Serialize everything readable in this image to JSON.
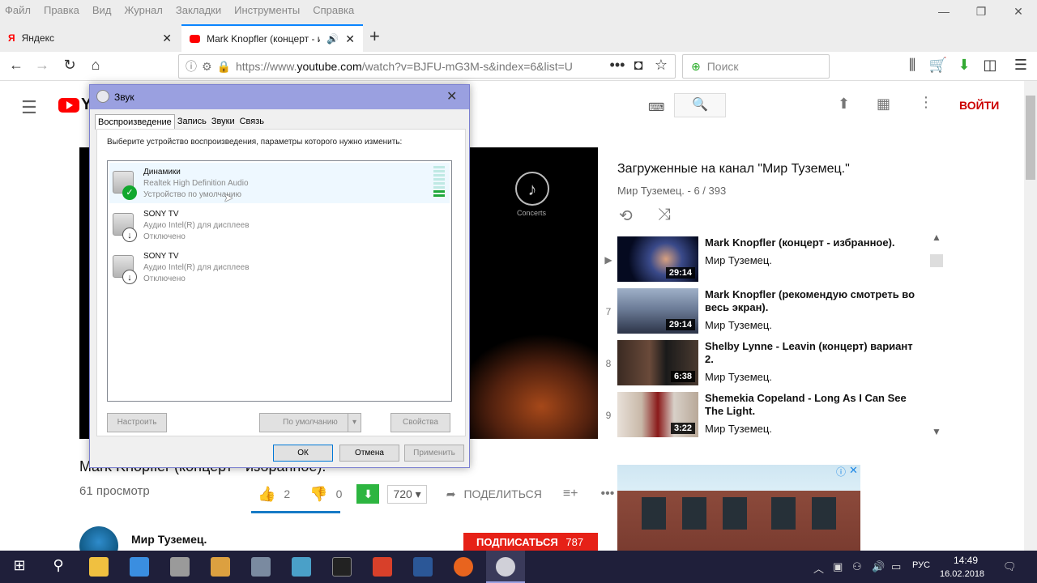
{
  "browser": {
    "menu": [
      "Файл",
      "Правка",
      "Вид",
      "Журнал",
      "Закладки",
      "Инструменты",
      "Справка"
    ],
    "tabs": [
      {
        "title": "Яндекс"
      },
      {
        "title": "Mark Knopfler (концерт - и"
      }
    ],
    "url_prefix": "https://www.",
    "url_host": "youtube.com",
    "url_rest": "/watch?v=BJFU-mG3M-s&index=6&list=U",
    "search_placeholder": "Поиск"
  },
  "youtube": {
    "logo_text": "Yo",
    "signin": "ВОЙТИ",
    "video_title": "Mark Knopfler (концерт - избранное).",
    "views": "61 просмотр",
    "likes": "2",
    "dislikes": "0",
    "quality": "720",
    "share": "ПОДЕЛИТЬСЯ",
    "channel": "Мир Туземец.",
    "subscribe": "ПОДПИСАТЬСЯ",
    "subscribers": "787",
    "concerts_label": "Concerts",
    "playlist": {
      "title": "Загруженные на канал \"Мир Туземец.\"",
      "subtitle": "Мир Туземец. - 6 / 393",
      "items": [
        {
          "index": "▶",
          "title": "Mark Knopfler (концерт - избранное).",
          "channel": "Мир Туземец.",
          "duration": "29:14"
        },
        {
          "index": "7",
          "title": "Mark Knopfler (рекомендую смотреть во весь экран).",
          "channel": "Мир Туземец.",
          "duration": "29:14"
        },
        {
          "index": "8",
          "title": "Shelby Lynne - Leavin (концерт) вариант 2.",
          "channel": "Мир Туземец.",
          "duration": "6:38"
        },
        {
          "index": "9",
          "title": "Shemekia Copeland - Long As I Can See The Light.",
          "channel": "Мир Туземец.",
          "duration": "3:22"
        }
      ]
    }
  },
  "dialog": {
    "title": "Звук",
    "tabs": [
      "Воспроизведение",
      "Запись",
      "Звуки",
      "Связь"
    ],
    "instruction": "Выберите устройство воспроизведения, параметры которого нужно изменить:",
    "devices": [
      {
        "name": "Динамики",
        "driver": "Realtek High Definition Audio",
        "status": "Устройство по умолчанию"
      },
      {
        "name": "SONY TV",
        "driver": "Аудио Intel(R) для дисплеев",
        "status": "Отключено"
      },
      {
        "name": "SONY TV",
        "driver": "Аудио Intel(R) для дисплеев",
        "status": "Отключено"
      }
    ],
    "btn_configure": "Настроить",
    "btn_default": "По умолчанию",
    "btn_properties": "Свойства",
    "btn_ok": "ОК",
    "btn_cancel": "Отмена",
    "btn_apply": "Применить"
  },
  "taskbar": {
    "lang": "РУС",
    "time": "14:49",
    "date": "16.02.2018"
  },
  "colors": {
    "yt_red": "#ff0000",
    "dialog_titlebar": "#9aa0e0",
    "firefox_accent": "#0a84ff",
    "download_green": "#2db540",
    "ok_green": "#11a82e"
  }
}
